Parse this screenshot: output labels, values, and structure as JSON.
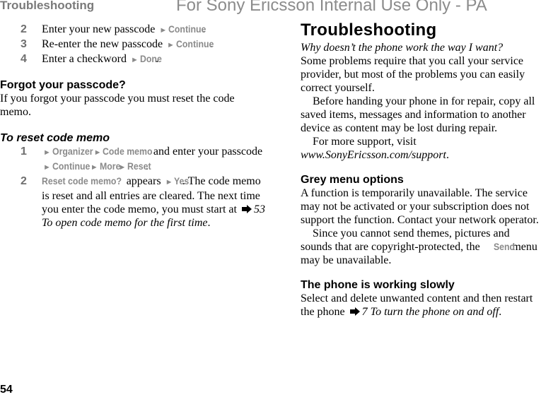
{
  "header": {
    "running_head": "Troubleshooting",
    "watermark": "For Sony Ericsson Internal Use Only - PA"
  },
  "footer": {
    "page_number": "54"
  },
  "left_column": {
    "steps_top": [
      {
        "num": "2",
        "text": "Enter your new passcode",
        "menu": [
          "Continue"
        ],
        "end": "."
      },
      {
        "num": "3",
        "text": "Re-enter the new passcode",
        "menu": [
          "Continue"
        ],
        "end": "."
      },
      {
        "num": "4",
        "text": "Enter a checkword",
        "menu": [
          "Done"
        ],
        "end": "."
      }
    ],
    "forgot": {
      "heading": "Forgot your passcode?",
      "body": "If you forgot your passcode you must reset the code memo."
    },
    "reset": {
      "heading": "To reset code memo",
      "step1": {
        "num": "1",
        "menu1": "Organizer",
        "menu2": "Code memo",
        "text1": " and enter your passcode ",
        "menu3": "Continue",
        "menu4": "More",
        "menu5": "Reset",
        "end": "."
      },
      "step2": {
        "num": "2",
        "menu1": "Reset code memo?",
        "text1": " appears ",
        "menu2": "Yes",
        "text2": ". The code memo is reset and all entries are cleared. The next time you enter the code memo, you must start at ",
        "xref": "53 To open code memo for the first time",
        "end": "."
      }
    }
  },
  "right_column": {
    "title": "Troubleshooting",
    "lead": "Why doesn’t the phone work the way I want?",
    "intro": "Some problems require that you call your service provider, but most of the problems you can easily correct yourself.",
    "repair": "Before handing your phone in for repair, copy all saved items, messages and information to another device as content may be lost during repair.",
    "support_prefix": "For more support, visit ",
    "support_url": "www.SonyEricsson.com/support",
    "support_end": ".",
    "grey": {
      "heading": "Grey menu options",
      "body": "A function is temporarily unavailable. The service may not be activated or your subscription does not support the function. Contact your network operator.",
      "body2_prefix": "Since you cannot send themes, pictures and sounds that are copyright-protected, the ",
      "body2_menu": "Send",
      "body2_suffix": " menu may be unavailable."
    },
    "slow": {
      "heading": "The phone is working slowly",
      "body_prefix": "Select and delete unwanted content and then restart the phone ",
      "xref": "7 To turn the phone on and off",
      "end": "."
    }
  },
  "icons": {
    "menu_arrow": "►",
    "xref_arrow": "arrow-right-icon"
  }
}
